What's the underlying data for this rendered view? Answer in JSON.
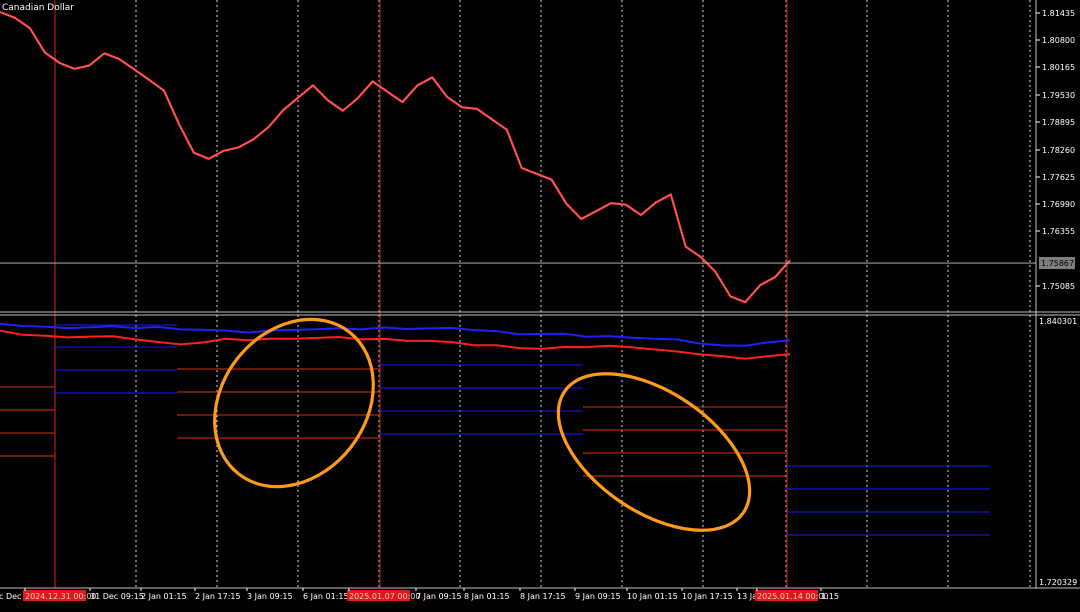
{
  "symbol_label": "Canadian Dollar",
  "colors": {
    "background": "#000000",
    "price_line": "#ff4444",
    "indicator_blue": "#2020ff",
    "indicator_red": "#ff2020",
    "blue_levels": "#1a1aff",
    "red_levels": "#e03010",
    "weekly_separator": "#8b1a1a",
    "grid": "#ffffff",
    "axis_text": "#ffffff",
    "annotation_circle": "#ff9a1a",
    "current_price_bg": "#7f7f7f",
    "date_highlight_bg": "#e01818"
  },
  "chart_data": [
    {
      "type": "line",
      "pane": "main",
      "series": [
        {
          "values": [
            1.813,
            1.812,
            1.81,
            1.805,
            1.802,
            1.801,
            1.802,
            1.804,
            1.803,
            1.801,
            1.799,
            1.796,
            1.789,
            1.783,
            1.781,
            1.783,
            1.784,
            1.786,
            1.788,
            1.792,
            1.795,
            1.797,
            1.794,
            1.792,
            1.795,
            1.798,
            1.796,
            1.794,
            1.797,
            1.799,
            1.795,
            1.793,
            1.792,
            1.79,
            1.788,
            1.779,
            1.778,
            1.777,
            1.772,
            1.768,
            1.77,
            1.772,
            1.771,
            1.769,
            1.772,
            1.774,
            1.762,
            1.76,
            1.757,
            1.751,
            1.75,
            1.754,
            1.756,
            1.759
          ]
        }
      ],
      "y_ticks": [
        "1.81435",
        "1.80800",
        "1.80165",
        "1.79530",
        "1.78895",
        "1.78260",
        "1.77625",
        "1.76990",
        "1.76355",
        "1.75085"
      ],
      "current_price": "1.75867",
      "ylim": [
        1.748,
        1.816
      ],
      "grid": true
    },
    {
      "type": "line",
      "pane": "indicator",
      "series": [
        {
          "color": "blue",
          "values": [
            1.836,
            1.8357,
            1.835,
            1.835,
            1.8349,
            1.8349,
            1.8348,
            1.8348,
            1.8344,
            1.8338,
            1.833,
            1.8328,
            1.8333,
            1.8342,
            1.834,
            1.834,
            1.8342,
            1.8346,
            1.8346,
            1.8344,
            1.8342,
            1.8339,
            1.833,
            1.8322,
            1.832,
            1.8316,
            1.831,
            1.8308,
            1.8307,
            1.8299,
            1.8291,
            1.828,
            1.8267,
            1.8272,
            1.8282,
            1.8287
          ]
        },
        {
          "color": "red",
          "values": [
            1.833,
            1.8318,
            1.831,
            1.8309,
            1.8308,
            1.8305,
            1.8298,
            1.8282,
            1.8278,
            1.8282,
            1.8294,
            1.8294,
            1.8297,
            1.8303,
            1.8302,
            1.8302,
            1.8298,
            1.8296,
            1.8294,
            1.8289,
            1.828,
            1.8272,
            1.8268,
            1.8262,
            1.8254,
            1.8258,
            1.8264,
            1.8266,
            1.8265,
            1.8252,
            1.8238,
            1.8232,
            1.822,
            1.8215,
            1.8222,
            1.8226
          ]
        }
      ],
      "y_ticks": [
        "1.840301",
        "1.720329"
      ],
      "ylim": [
        1.720329,
        1.840301
      ]
    }
  ],
  "x_labels": [
    "c Dec 01:15",
    "2024.12.31 00:00",
    "31 Dec 09:15",
    "2 Jan 01:15",
    "2 Jan 17:15",
    "3 Jan 09:15",
    "6 Jan 01:15",
    "2025.01.07 00:00",
    "7 Jan 09:15",
    "8 Jan 01:15",
    "8 Jan 17:15",
    "9 Jan 09:15",
    "10 Jan 01:15",
    "10 Jan 17:15",
    "13 Ja",
    "2025.01.14 00:00",
    "1:15"
  ],
  "highlighted_x_labels": [
    1,
    7,
    15
  ]
}
